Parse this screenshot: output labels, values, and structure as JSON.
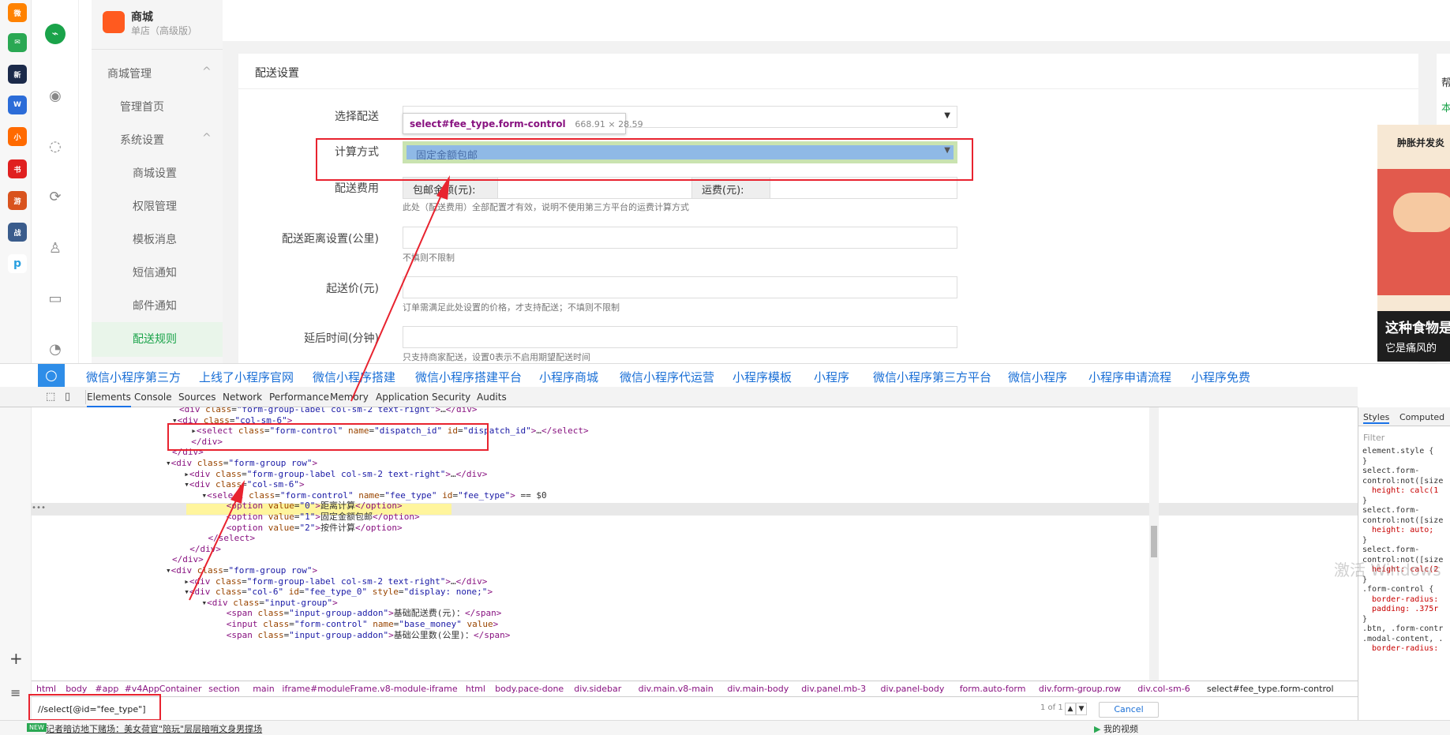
{
  "dock": {
    "items": [
      "weibo",
      "mail",
      "news",
      "word",
      "novel",
      "xhs",
      "game",
      "game2",
      "pp"
    ],
    "plus": "+",
    "menu": "≡"
  },
  "nav1": {
    "icons": [
      "link-icon",
      "eye-icon",
      "chat-icon",
      "refresh-icon",
      "user-icon",
      "message-icon",
      "pie-icon"
    ]
  },
  "sidebar": {
    "brand": "商城",
    "subtitle": "单店（高级版）",
    "items": [
      {
        "label": "商城管理",
        "arrow": "^"
      },
      {
        "label": "管理首页"
      },
      {
        "label": "系统设置",
        "arrow": "^"
      },
      {
        "label": "商城设置"
      },
      {
        "label": "权限管理"
      },
      {
        "label": "模板消息"
      },
      {
        "label": "短信通知"
      },
      {
        "label": "邮件通知"
      },
      {
        "label": "配送规则"
      }
    ]
  },
  "form": {
    "title": "配送设置",
    "dispatch_label": "选择配送",
    "calc_label": "计算方式",
    "calc_value": "固定金额包邮",
    "fee_label": "配送费用",
    "free_addon": "包邮金额(元):",
    "ship_addon": "运费(元):",
    "fee_hint": "此处（配送费用）全部配置才有效，说明不使用第三方平台的运费计算方式",
    "dist_label": "配送距离设置(公里)",
    "dist_hint": "不填则不限制",
    "min_label": "起送价(元)",
    "min_hint": "订单需满足此处设置的价格，才支持配送；不填则不限制",
    "delay_label": "延后时间(分钟)",
    "delay_hint": "只支持商家配送，设置0表示不启用期望配送时间"
  },
  "tooltip": {
    "selector": "select#fee_type.form-control",
    "size": "668.91 × 28.59"
  },
  "ad": {
    "right_char": "帮",
    "right_char2": "本",
    "headline": "肿胀并发炎",
    "cap1": "这种食物是",
    "cap2": "它是痛风的",
    "watermark": "激活 Windows"
  },
  "search_bar": [
    "微信小程序第三方",
    "上线了小程序官网",
    "微信小程序搭建",
    "微信小程序搭建平台",
    "小程序商城",
    "微信小程序代运营",
    "小程序模板",
    "小程序",
    "微信小程序第三方平台",
    "微信小程序",
    "小程序申请流程",
    "小程序免费"
  ],
  "devtools": {
    "tabs": [
      "Elements",
      "Console",
      "Sources",
      "Network",
      "Performance",
      "Memory",
      "Application",
      "Security",
      "Audits"
    ],
    "active": "Elements",
    "styles_tabs": [
      "Styles",
      "Computed"
    ],
    "filter": "Filter",
    "console_marker": "== $0",
    "dots": "•••"
  },
  "code": [
    {
      "html": "<span class='tg'>&lt;div</span> <span class='at'>class</span>=<span class='av'>\"form-group-label col-sm-2 text-right\"</span><span class='tg'>&gt;</span>…<span class='tg'>&lt;/div&gt;</span>"
    },
    {
      "html": "▾<span class='tg'>&lt;div</span> <span class='at'>class</span>=<span class='av'>\"col-sm-6\"</span><span class='tg'>&gt;</span>"
    },
    {
      "html": "  ▸<span class='tg'>&lt;select</span> <span class='at'>class</span>=<span class='av'>\"form-control\"</span> <span class='at'>name</span>=<span class='av'>\"dispatch_id\"</span> <span class='at'>id</span>=<span class='av'>\"dispatch_id\"</span><span class='tg'>&gt;</span>…<span class='tg'>&lt;/select&gt;</span>"
    },
    {
      "html": "  <span class='tg'>&lt;/div&gt;</span>"
    },
    {
      "html": "<span class='tg'>&lt;/div&gt;</span>"
    },
    {
      "html": "▾<span class='tg'>&lt;div</span> <span class='at'>class</span>=<span class='av'>\"form-group row\"</span><span class='tg'>&gt;</span>"
    },
    {
      "html": "  ▸<span class='tg'>&lt;div</span> <span class='at'>class</span>=<span class='av'>\"form-group-label col-sm-2 text-right\"</span><span class='tg'>&gt;</span>…<span class='tg'>&lt;/div&gt;</span>"
    },
    {
      "html": "  ▾<span class='tg'>&lt;div</span> <span class='at'>class</span>=<span class='av'>\"col-sm-6\"</span><span class='tg'>&gt;</span>"
    },
    {
      "html": "    ▾<span class='tg'>&lt;select</span> <span class='at'>class</span>=<span class='av'>\"form-control\"</span> <span class='at'>name</span>=<span class='av'>\"fee_type\"</span> <span class='at'>id</span>=<span class='av'>\"fee_type\"</span><span class='tg'>&gt;</span> == $0"
    },
    {
      "html": "      <span class='tg'>&lt;option</span> <span class='at'>value</span>=<span class='av'>\"0\"</span><span class='tg'>&gt;</span>距离计算<span class='tg'>&lt;/option&gt;</span>"
    },
    {
      "html": "      <span class='tg'>&lt;option</span> <span class='at'>value</span>=<span class='av'>\"1\"</span><span class='tg'>&gt;</span>固定金额包邮<span class='tg'>&lt;/option&gt;</span>"
    },
    {
      "html": "      <span class='tg'>&lt;option</span> <span class='at'>value</span>=<span class='av'>\"2\"</span><span class='tg'>&gt;</span>按件计算<span class='tg'>&lt;/option&gt;</span>"
    },
    {
      "html": "    <span class='tg'>&lt;/select&gt;</span>"
    },
    {
      "html": "  <span class='tg'>&lt;/div&gt;</span>"
    },
    {
      "html": "<span class='tg'>&lt;/div&gt;</span>"
    },
    {
      "html": "▾<span class='tg'>&lt;div</span> <span class='at'>class</span>=<span class='av'>\"form-group row\"</span><span class='tg'>&gt;</span>"
    },
    {
      "html": "  ▸<span class='tg'>&lt;div</span> <span class='at'>class</span>=<span class='av'>\"form-group-label col-sm-2 text-right\"</span><span class='tg'>&gt;</span>…<span class='tg'>&lt;/div&gt;</span>"
    },
    {
      "html": "  ▾<span class='tg'>&lt;div</span> <span class='at'>class</span>=<span class='av'>\"col-6\"</span> <span class='at'>id</span>=<span class='av'>\"fee_type_0\"</span> <span class='at'>style</span>=<span class='av'>\"display: none;\"</span><span class='tg'>&gt;</span>"
    },
    {
      "html": "    ▾<span class='tg'>&lt;div</span> <span class='at'>class</span>=<span class='av'>\"input-group\"</span><span class='tg'>&gt;</span>"
    },
    {
      "html": "      <span class='tg'>&lt;span</span> <span class='at'>class</span>=<span class='av'>\"input-group-addon\"</span><span class='tg'>&gt;</span>基础配送费(元)：<span class='tg'>&lt;/span&gt;</span>"
    },
    {
      "html": "      <span class='tg'>&lt;input</span> <span class='at'>class</span>=<span class='av'>\"form-control\"</span> <span class='at'>name</span>=<span class='av'>\"base_money\"</span> <span class='at'>value</span><span class='tg'>&gt;</span>"
    },
    {
      "html": "      <span class='tg'>&lt;span</span> <span class='at'>class</span>=<span class='av'>\"input-group-addon\"</span><span class='tg'>&gt;</span>基础公里数(公里)：<span class='tg'>&lt;/span&gt;</span>"
    }
  ],
  "crumbs": [
    "html",
    "body",
    "#app",
    "#v4AppContainer",
    "section",
    "main",
    "iframe#moduleFrame.v8-module-iframe",
    "html",
    "body.pace-done",
    "div.sidebar",
    "div.main.v8-main",
    "div.main-body",
    "div.panel.mb-3",
    "div.panel-body",
    "form.auto-form",
    "div.form-group.row",
    "div.col-sm-6",
    "select#fee_type.form-control"
  ],
  "search": {
    "value": "//select[@id=\"fee_type\"]",
    "count": "1 of 1",
    "cancel": "Cancel"
  },
  "styles_lines": [
    "element.style {",
    "}",
    "select.form-",
    "control:not([size",
    "  height: calc(1",
    "}",
    "select.form-",
    "control:not([size",
    "  height: auto;",
    "}",
    "select.form-",
    "control:not([size",
    "  height: calc(2",
    "}",
    ".form-control {",
    "  border-radius:",
    "  padding: .375r",
    "}",
    ".btn, .form-contr",
    ".modal-content, .",
    "  border-radius:"
  ],
  "status": {
    "badge": "NEW",
    "text": "记者暗访地下赌场：美女荷官\"陪玩\"层层暗哨文身男撑场",
    "video": "我的视频"
  },
  "colors": {
    "accent": "#ff6a00",
    "red": "#e8232f",
    "link": "#1a6fd6",
    "highlight": "#fff59d"
  }
}
